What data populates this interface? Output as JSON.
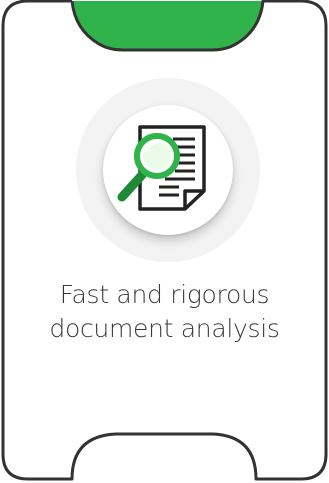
{
  "feature_card": {
    "caption_line1": "Fast and rigorous",
    "caption_line2": "document analysis",
    "icon": "document-magnifier-icon",
    "colors": {
      "accent_green": "#2fb34a",
      "border": "#333333",
      "text": "#3a3a3a",
      "halo": "#f3f3f3"
    }
  }
}
